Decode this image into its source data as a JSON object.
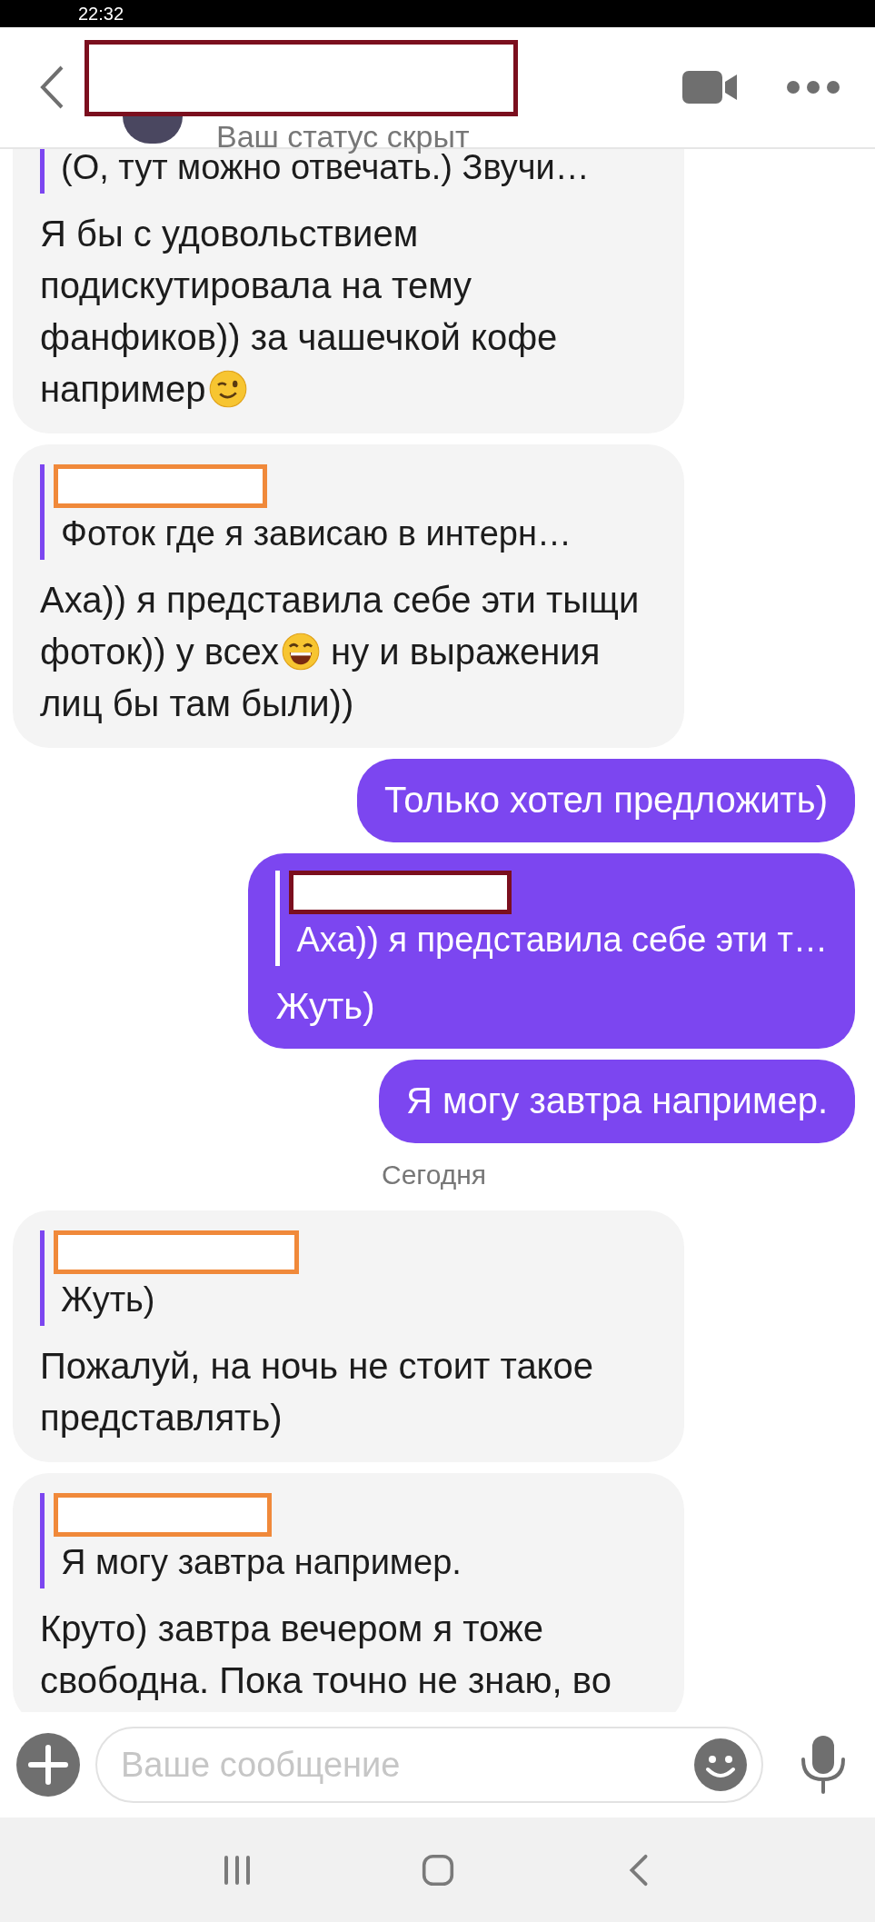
{
  "status_bar": {
    "time": "22:32"
  },
  "header": {
    "subtitle": "Ваш статус скрыт"
  },
  "messages": [
    {
      "kind": "message",
      "outgoing": false,
      "quote": "(О, тут можно отвечать.) Звучи…",
      "parts": [
        {
          "kind": "text",
          "text": "Я бы с удовольствием подискутировала на тему фанфиков)) за чашечкой кофе например"
        },
        {
          "kind": "wink"
        }
      ]
    },
    {
      "kind": "message",
      "outgoing": false,
      "quote": "Фоток где я зависаю в интерн…",
      "parts": [
        {
          "kind": "text",
          "text": "Аха)) я представила себе эти тыщи фоток)) у всех"
        },
        {
          "kind": "grin"
        },
        {
          "kind": "text",
          "text": " ну и выражения лиц бы там были))"
        }
      ]
    },
    {
      "kind": "message",
      "outgoing": true,
      "parts": [
        {
          "kind": "text",
          "text": "Только хотел предложить)"
        }
      ]
    },
    {
      "kind": "message",
      "outgoing": true,
      "quote": "Аха)) я представила себе эти т…",
      "parts": [
        {
          "kind": "text",
          "text": "Жуть)"
        }
      ]
    },
    {
      "kind": "message",
      "outgoing": true,
      "parts": [
        {
          "kind": "text",
          "text": "Я могу завтра например."
        }
      ]
    },
    {
      "kind": "date",
      "text": "Сегодня"
    },
    {
      "kind": "message",
      "outgoing": false,
      "quote": "Жуть)",
      "parts": [
        {
          "kind": "text",
          "text": "Пожалуй, на ночь не стоит такое представлять)"
        }
      ]
    },
    {
      "kind": "message",
      "outgoing": false,
      "quote": "Я могу завтра например.",
      "parts": [
        {
          "kind": "text",
          "text": "Круто) завтра вечером я тоже свободна. Пока точно не знаю, во"
        }
      ]
    }
  ],
  "composer": {
    "placeholder": "Ваше сообщение"
  }
}
